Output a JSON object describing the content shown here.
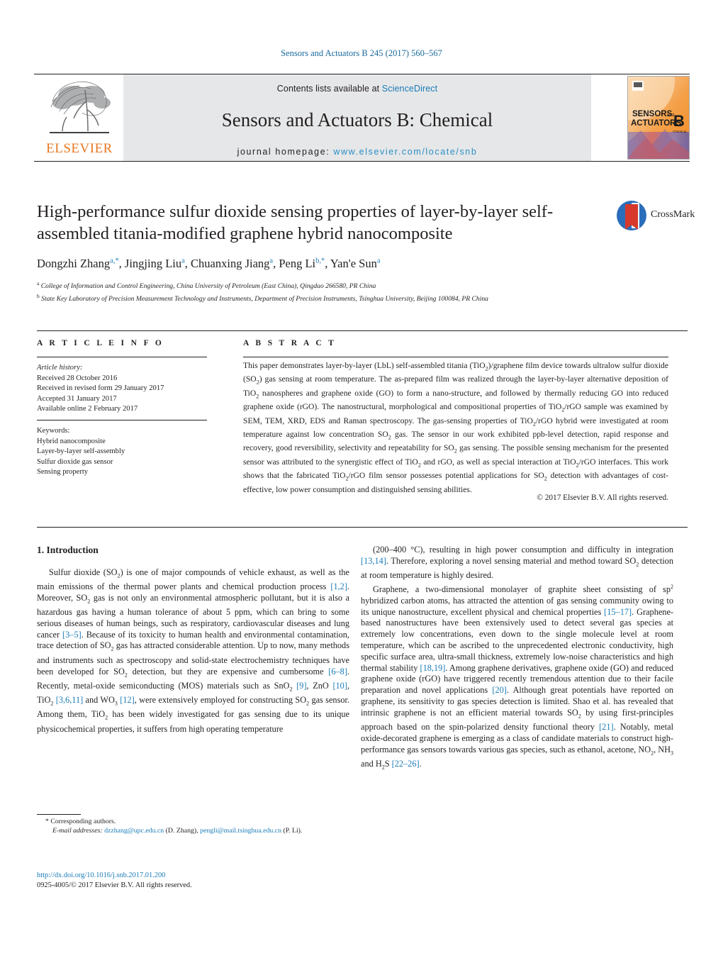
{
  "running_head": "Sensors and Actuators B 245 (2017) 560–567",
  "masthead": {
    "publisher_name": "ELSEVIER",
    "contents_prefix": "Contents lists available at ",
    "contents_link": "ScienceDirect",
    "journal_title": "Sensors and Actuators B: Chemical",
    "homepage_prefix": "journal homepage: ",
    "homepage_url": "www.elsevier.com/locate/snb",
    "cover_line1": "SENSORS",
    "cover_and": "and",
    "cover_line2": "ACTUATORS",
    "cover_letter": "B",
    "cover_sub": "Chemical"
  },
  "crossmark": {
    "label": "CrossMark"
  },
  "article": {
    "title": "High-performance sulfur dioxide sensing properties of layer-by-layer self-assembled titania-modified graphene hybrid nanocomposite",
    "authors_html": "Dongzhi Zhang<sup>a,*</sup>, Jingjing Liu<sup>a</sup>, Chuanxing Jiang<sup>a</sup>, Peng Li<sup>b,*</sup>, Yan'e Sun<sup>a</sup>",
    "affiliation_a": "College of Information and Control Engineering, China University of Petroleum (East China), Qingdao 266580, PR China",
    "affiliation_b": "State Key Laboratory of Precision Measurement Technology and Instruments, Department of Precision Instruments, Tsinghua University, Beijing 100084, PR China"
  },
  "article_info": {
    "heading": "A R T I C L E   I N F O",
    "history_label": "Article history:",
    "history": [
      "Received 28 October 2016",
      "Received in revised form 29 January 2017",
      "Accepted 31 January 2017",
      "Available online 2 February 2017"
    ],
    "keywords_label": "Keywords:",
    "keywords": [
      "Hybrid nanocomposite",
      "Layer-by-layer self-assembly",
      "Sulfur dioxide gas sensor",
      "Sensing property"
    ]
  },
  "abstract": {
    "heading": "A B S T R A C T",
    "text_html": "This paper demonstrates layer-by-layer (LbL) self-assembled titania (TiO<sub>2</sub>)/graphene film device towards ultralow sulfur dioxide (SO<sub>2</sub>) gas sensing at room temperature. The as-prepared film was realized through the layer-by-layer alternative deposition of TiO<sub>2</sub> nanospheres and graphene oxide (GO) to form a nano-structure, and followed by thermally reducing GO into reduced graphene oxide (rGO). The nanostructural, morphological and compositional properties of TiO<sub>2</sub>/rGO sample was examined by SEM, TEM, XRD, EDS and Raman spectroscopy. The gas-sensing properties of TiO<sub>2</sub>/rGO hybrid were investigated at room temperature against low concentration SO<sub>2</sub> gas. The sensor in our work exhibited ppb-level detection, rapid response and recovery, good reversibility, selectivity and repeatability for SO<sub>2</sub> gas sensing. The possible sensing mechanism for the presented sensor was attributed to the synergistic effect of TiO<sub>2</sub> and rGO, as well as special interaction at TiO<sub>2</sub>/rGO interfaces. This work shows that the fabricated TiO<sub>2</sub>/rGO film sensor possesses potential applications for SO<sub>2</sub> detection with advantages of cost-effective, low power consumption and distinguished sensing abilities.",
    "copyright": "© 2017 Elsevier B.V. All rights reserved."
  },
  "body": {
    "section_heading": "1.  Introduction",
    "left_p1_html": "Sulfur dioxide (SO<sub>2</sub>) is one of major compounds of vehicle exhaust, as well as the main emissions of the thermal power plants and chemical production process <span class=\"ref\">[1,2]</span>. Moreover, SO<sub>2</sub> gas is not only an environmental atmospheric pollutant, but it is also a hazardous gas having a human tolerance of about 5 ppm, which can bring to some serious diseases of human beings, such as respiratory, cardiovascular diseases and lung cancer <span class=\"ref\">[3–5]</span>. Because of its toxicity to human health and environmental contamination, trace detection of SO<sub>2</sub> gas has attracted considerable attention. Up to now, many methods and instruments such as spectroscopy and solid-state electrochemistry techniques have been developed for SO<sub>2</sub> detection, but they are expensive and cumbersome <span class=\"ref\">[6–8]</span>. Recently, metal-oxide semiconducting (MOS) materials such as SnO<sub>2</sub> <span class=\"ref\">[9]</span>, ZnO <span class=\"ref\">[10]</span>, TiO<sub>2</sub> <span class=\"ref\">[3,6,11]</span> and WO<sub>3</sub> <span class=\"ref\">[12]</span>, were extensively employed for constructing SO<sub>2</sub> gas sensor. Among them, TiO<sub>2</sub> has been widely investigated for gas sensing due to its unique physicochemical properties, it suffers from high operating temperature",
    "right_p1_html": "(200–400 °C), resulting in high power consumption and difficulty in integration <span class=\"ref\">[13,14]</span>. Therefore, exploring a novel sensing material and method toward SO<sub>2</sub> detection at room temperature is highly desired.",
    "right_p2_html": "Graphene, a two-dimensional monolayer of graphite sheet consisting of sp<sup>2</sup> hybridized carbon atoms, has attracted the attention of gas sensing community owing to its unique nanostructure, excellent physical and chemical properties <span class=\"ref\">[15–17]</span>. Graphene-based nanostructures have been extensively used to detect several gas species at extremely low concentrations, even down to the single molecule level at room temperature, which can be ascribed to the unprecedented electronic conductivity, high specific surface area, ultra-small thickness, extremely low-noise characteristics and high thermal stability <span class=\"ref\">[18,19]</span>. Among graphene derivatives, graphene oxide (GO) and reduced graphene oxide (rGO) have triggered recently tremendous attention due to their facile preparation and novel applications <span class=\"ref\">[20]</span>. Although great potentials have reported on graphene, its sensitivity to gas species detection is limited. Shao et al. has revealed that intrinsic graphene is not an efficient material towards SO<sub>2</sub> by using first-principles approach based on the spin-polarized density functional theory <span class=\"ref\">[21]</span>. Notably, metal oxide-decorated graphene is emerging as a class of candidate materials to construct high-performance gas sensors towards various gas species, such as ethanol, acetone, NO<sub>2</sub>, NH<sub>3</sub> and H<sub>2</sub>S <span class=\"ref\">[22–26]</span>."
  },
  "footnotes": {
    "corresponding": "*  Corresponding authors.",
    "email_label": "E-mail addresses:",
    "email1": "dzzhang@upc.edu.cn",
    "email1_owner": "(D. Zhang),",
    "email2": "pengli@mail.tsinghua.edu.cn",
    "email2_owner": "(P. Li).",
    "doi": "http://dx.doi.org/10.1016/j.snb.2017.01.200",
    "issn_line": "0925-4005/© 2017 Elsevier B.V. All rights reserved."
  },
  "colors": {
    "link": "#1a7cb8",
    "elsevier_orange": "#e87722",
    "masthead_bg": "#e6e7e8",
    "crossmark_blue": "#2a6ebb",
    "crossmark_red": "#d7382c"
  }
}
